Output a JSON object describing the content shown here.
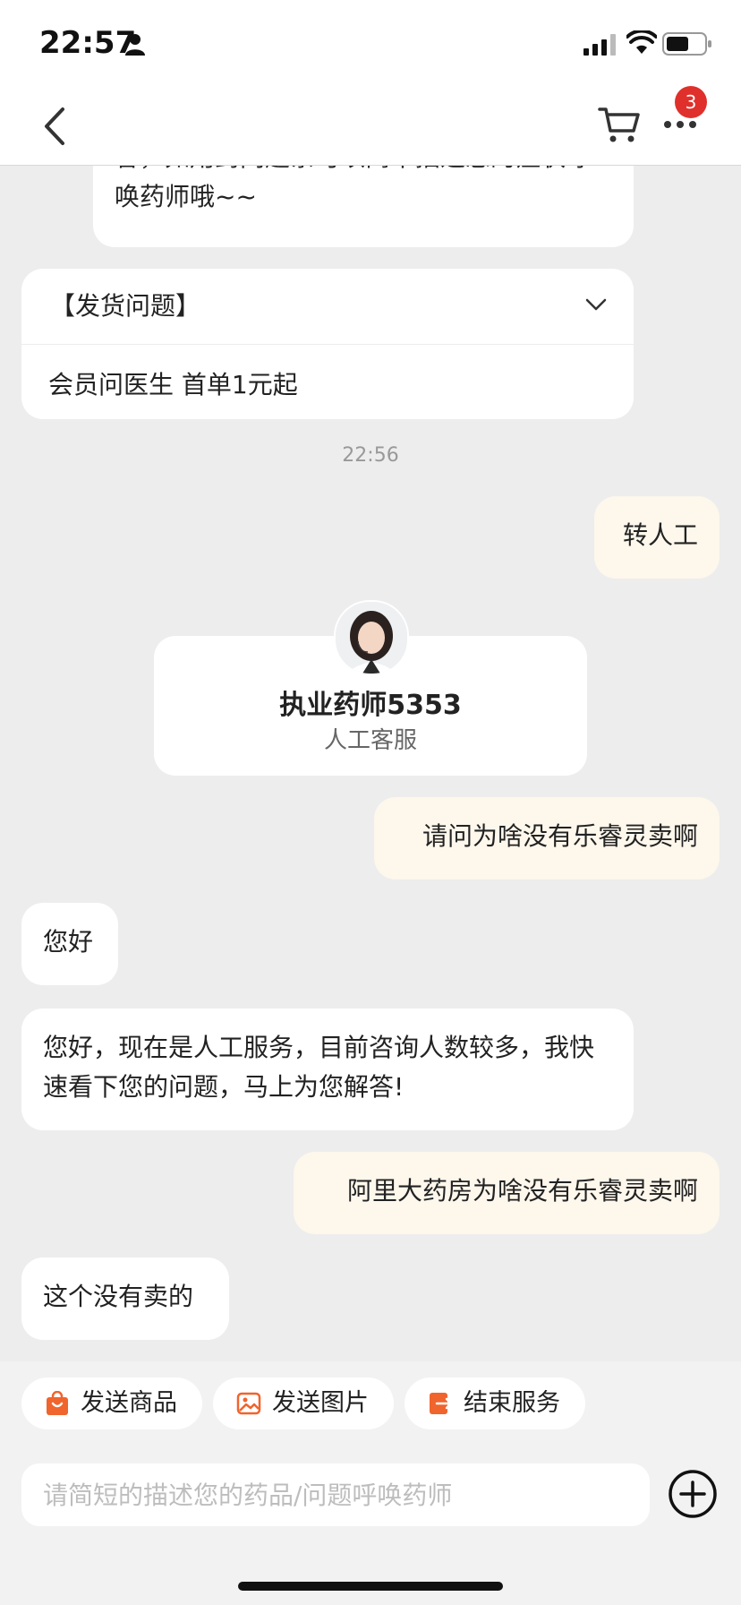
{
  "status_bar": {
    "time": "22:57"
  },
  "nav": {
    "cart_badge": "3"
  },
  "messages": {
    "top_partial": "答，如用药问题亲可以简单描述您的症状呼唤药师哦~~",
    "faq_title": "【发货问题】",
    "faq_item": "会员问医生 首单1元起",
    "timestamp": "22:56",
    "user_1": "转人工",
    "agent_name": "执业药师5353",
    "agent_role": "人工客服",
    "user_2": "请问为啥没有乐睿灵卖啊",
    "agent_1": "您好",
    "agent_2": "您好，现在是人工服务，目前咨询人数较多，我快速看下您的问题，马上为您解答!",
    "user_3": "阿里大药房为啥没有乐睿灵卖啊",
    "agent_3": "这个没有卖的"
  },
  "quick_actions": {
    "send_product": "发送商品",
    "send_image": "发送图片",
    "end_service": "结束服务"
  },
  "input": {
    "placeholder": "请简短的描述您的药品/问题呼唤药师"
  },
  "colors": {
    "accent": "#f0642d",
    "badge": "#e0302b",
    "user_bubble": "#fdf7ec"
  },
  "icons": [
    "person-icon",
    "signal-icon",
    "wifi-icon",
    "battery-icon",
    "back-arrow-icon",
    "cart-icon",
    "more-icon",
    "chevron-down-icon",
    "shopping-bag-icon",
    "image-icon",
    "exit-icon",
    "plus-circle-icon"
  ]
}
